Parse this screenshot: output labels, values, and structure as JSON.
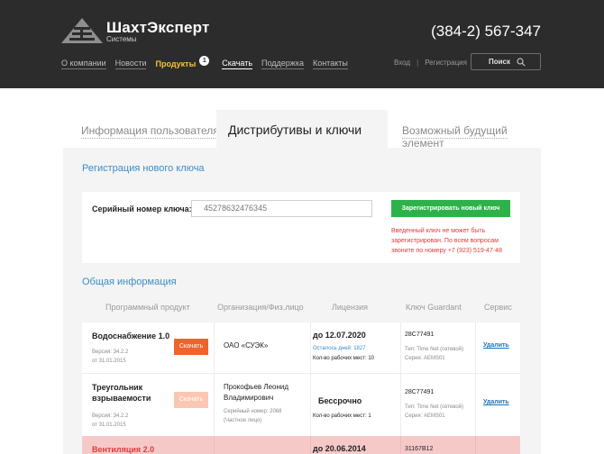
{
  "header": {
    "brand_name": "ШахтЭксперт",
    "brand_sub": "Системы",
    "phone": "(384-2) 567-347",
    "nav": [
      {
        "label": "О компании"
      },
      {
        "label": "Новости"
      },
      {
        "label": "Продукты",
        "badge": "1"
      },
      {
        "label": "Скачать"
      },
      {
        "label": "Поддержка"
      },
      {
        "label": "Контакты"
      }
    ],
    "login": "Вход",
    "separator": "|",
    "register": "Регистрация",
    "search_label": "Поиск"
  },
  "tabs": [
    {
      "label": "Информация пользователя"
    },
    {
      "label": "Дистрибутивы и ключи"
    },
    {
      "label": "Возможный будущий элемент"
    }
  ],
  "registration": {
    "title": "Регистрация нового ключа",
    "serial_label": "Серийный номер ключа:",
    "serial_value": "45278632476345",
    "submit_label": "Зарегистрировать новый ключ",
    "warning": "Введенный ключ не может быть зарегистрирован. По всем вопросам звоните по номеру +7 (923) 519-47-48"
  },
  "general": {
    "title": "Общая информация",
    "columns": [
      "Программный продукт",
      "Организация/Физ.лицо",
      "Лицензия",
      "Ключ Guardant",
      "Сервис"
    ],
    "rows": [
      {
        "product": "Водоснабжение 1.0",
        "version": "Версия: 34.2.2",
        "date": "от 31.01.2015",
        "download": "Скачать",
        "org": "ОАО «СУЭК»",
        "org_note": "",
        "license": "до 12.07.2020",
        "days_left": "Осталось дней: 1827",
        "workplaces": "Кол-во рабочих мест: 10",
        "key_id": "28C77491",
        "key_type": "Тип: Time Net (сетевой)",
        "key_series": "Серия: AEMS01",
        "service": "Удалить"
      },
      {
        "product": "Треугольник взрываемости",
        "version": "Версия: 34.2.2",
        "date": "от 31.01.2015",
        "download": "Скачать",
        "org": "Прокофьев Леонид Владимирович",
        "org_note": "Серийный номер: 2068 (Частное лицо)",
        "license": "Бессрочно",
        "days_left": "",
        "workplaces": "Кол-во рабочих мест: 1",
        "key_id": "28C77491",
        "key_type": "Тип: Time Net (сетевой)",
        "key_series": "Серия: AEMS01",
        "service": "Удалить"
      },
      {
        "product": "Вентиляция 2.0",
        "license": "до 20.06.2014",
        "key_id": "31167B12"
      }
    ]
  },
  "colors": {
    "header_bg": "#2c2c2c",
    "accent_blue": "#3a8ec6",
    "active_nav": "#f5c33b",
    "register_green": "#2db24a",
    "download_orange": "#f0632d",
    "error_red": "#e33b3b",
    "expired_row": "#f6c9c9"
  },
  "icons": [
    "logo-mark",
    "search-icon"
  ]
}
